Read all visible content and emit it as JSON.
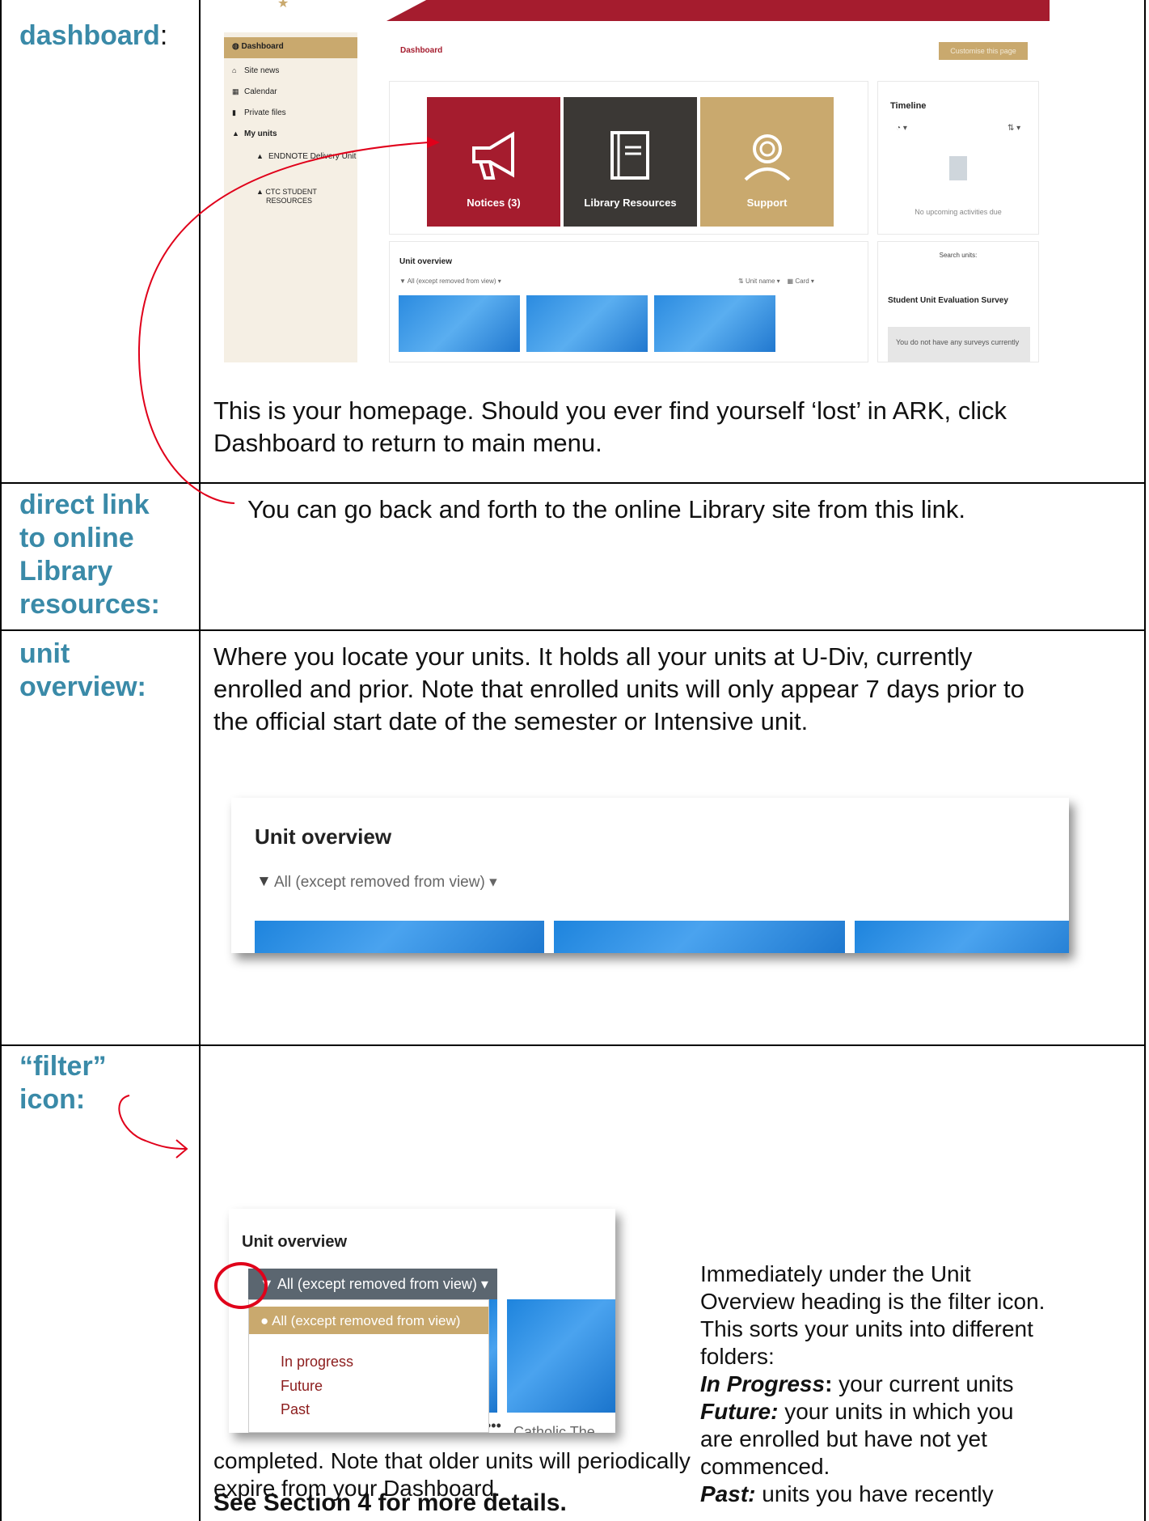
{
  "labels": {
    "dashboard": "dashboard",
    "dashboard_colon": ":",
    "direct_link": [
      "direct link",
      "to online",
      "Library",
      "resources:"
    ],
    "unit_overview": [
      "unit",
      "overview:"
    ],
    "filter_icon": [
      "“filter”",
      "icon:"
    ]
  },
  "dashboard_shot": {
    "sidebar_active": "Dashboard",
    "sidebar_items": [
      "Site news",
      "Calendar",
      "Private files",
      "My units"
    ],
    "sub_units": [
      "ENDNOTE Delivery Unit",
      "CTC STUDENT",
      "RESOURCES"
    ],
    "page_title": "Dashboard",
    "customise_button": "Customise this page",
    "tiles": [
      "Notices (3)",
      "Library Resources",
      "Support"
    ],
    "timeline_title": "Timeline",
    "timeline_empty": "No upcoming activities due",
    "unit_overview_title": "Unit overview",
    "filter_label": "All (except removed from view)",
    "sort_label": "Unit name",
    "view_label": "Card",
    "search_label": "Search units:",
    "survey_title": "Student Unit Evaluation Survey",
    "survey_text": "You do not have any surveys currently"
  },
  "dashboard_desc": [
    "This is your homepage.  Should you ever find yourself ‘lost’ in ARK, click",
    "Dashboard to return to main menu."
  ],
  "direct_link_desc": "You can go back and forth to the online Library site from this link.",
  "unit_overview_desc": [
    "Where you locate your units. It holds all your units at U-Div, currently",
    "enrolled and prior. Note that enrolled units will only appear 7 days prior to",
    "the official start date of the semester or Intensive unit."
  ],
  "unit_overview_shot": {
    "title": "Unit overview",
    "filter": "All (except removed from view)"
  },
  "filter_shot": {
    "title": "Unit overview",
    "button": "All (except removed from view)",
    "selected": "All (except removed from view)",
    "options": [
      "In progress",
      "Future",
      "Past"
    ],
    "card_caption": "Catholic The"
  },
  "filter_desc": {
    "lines": [
      "Immediately under the Unit",
      "Overview heading is the filter icon.",
      "This sorts your units into different",
      "folders:"
    ],
    "in_progress_term": "In Progress",
    "in_progress_colon": ":",
    "in_progress_text": " your current units",
    "future_term": "Future:",
    "future_text": " your units in which you",
    "future_cont": [
      "are enrolled but have not yet",
      "commenced."
    ],
    "past_term": "Past:",
    "past_text": " units you have recently",
    "bottom_lines": [
      "completed. Note that older units will periodically",
      "expire from your Dashboard."
    ],
    "see_section": "See Section 4 for more details."
  },
  "colors": {
    "label_teal": "#3a8aa8",
    "brand_red": "#a51c2e",
    "brand_tan": "#c9a96e",
    "arrow_red": "#e0001a"
  }
}
